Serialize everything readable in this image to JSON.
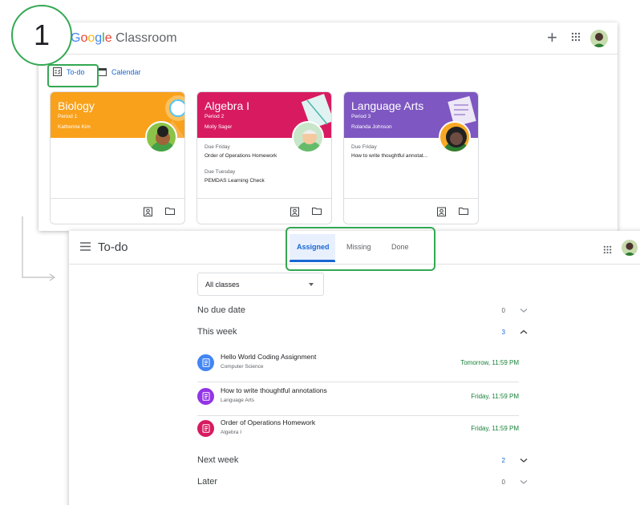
{
  "step": {
    "number": "1"
  },
  "classroom": {
    "logo_g": "G",
    "logo_o1": "o",
    "logo_o2": "o",
    "logo_g2": "g",
    "logo_l": "l",
    "logo_e": "e",
    "logo_rest": " Classroom",
    "nav": {
      "todo_label": "To-do",
      "calendar_label": "Calendar"
    },
    "cards": [
      {
        "title": "Biology",
        "period": "Period 1",
        "teacher": "Katherine Kim",
        "color": "#f9a11b",
        "due": []
      },
      {
        "title": "Algebra I",
        "period": "Period 2",
        "teacher": "Molly Sager",
        "color": "#d81b60",
        "due": [
          {
            "label": "Due Friday",
            "text": "Order of Operations Homework"
          },
          {
            "label": "Due Tuesday",
            "text": "PEMDAS Learning Check"
          }
        ]
      },
      {
        "title": "Language Arts",
        "period": "Period 3",
        "teacher": "Rolanda Johnson",
        "color": "#7e57c2",
        "due": [
          {
            "label": "Due Friday",
            "text": "How to write thoughtful annotat..."
          }
        ]
      }
    ]
  },
  "todo": {
    "title": "To-do",
    "tabs": [
      {
        "label": "Assigned",
        "active": true
      },
      {
        "label": "Missing",
        "active": false
      },
      {
        "label": "Done",
        "active": false
      }
    ],
    "filter": {
      "value": "All classes"
    },
    "sections": [
      {
        "label": "No due date",
        "count": "0",
        "expanded": false
      },
      {
        "label": "This week",
        "count": "3",
        "expanded": true
      },
      {
        "label": "Next week",
        "count": "2",
        "expanded": false
      },
      {
        "label": "Later",
        "count": "0",
        "expanded": false
      }
    ],
    "items": [
      {
        "title": "Hello World Coding Assignment",
        "class": "Computer Science",
        "due": "Tomorrow, 11:59 PM",
        "color": "#4285f4"
      },
      {
        "title": "How to write thoughtful annotations",
        "class": "Language Arts",
        "due": "Friday, 11:59 PM",
        "color": "#9334e6"
      },
      {
        "title": "Order of Operations Homework",
        "class": "Algebra I",
        "due": "Friday, 11:59 PM",
        "color": "#d81b60"
      }
    ]
  },
  "colors": {
    "accent_blue": "#1967d2",
    "highlight_green": "#34a853",
    "due_green": "#188038"
  }
}
